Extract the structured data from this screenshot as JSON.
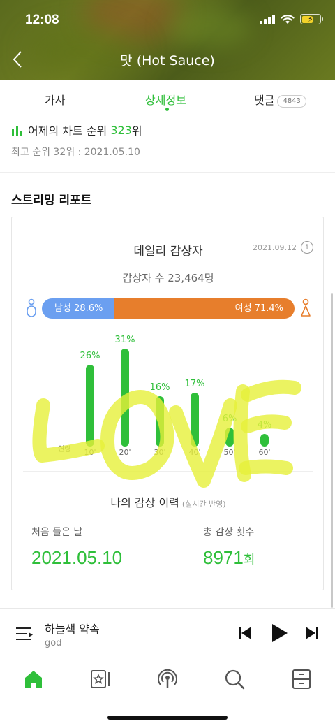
{
  "status_bar": {
    "time": "12:08"
  },
  "header": {
    "title": "맛 (Hot Sauce)"
  },
  "tabs": [
    {
      "label": "가사"
    },
    {
      "label": "상세정보"
    },
    {
      "label": "댓글",
      "badge": "4843"
    }
  ],
  "chart_rank": {
    "prefix": "어제의 차트 순위",
    "value": "323",
    "suffix": "위",
    "best": "최고 순위 32위 : 2021.05.10"
  },
  "streaming_report": {
    "section_title": "스트리밍 리포트",
    "card_title": "데일리 감상자",
    "date": "2021.09.12",
    "listener_count": "감상자 수 23,464명",
    "gender": {
      "male_label": "남성 28.6%",
      "female_label": "여성 71.4%",
      "male_pct": 28.6,
      "female_pct": 71.4,
      "male_color": "#6b9ff0",
      "female_color": "#e77e2c"
    },
    "age_axis_label": "연령",
    "ages": [
      {
        "label": "10'",
        "pct": 26,
        "pct_label": "26%"
      },
      {
        "label": "20'",
        "pct": 31,
        "pct_label": "31%"
      },
      {
        "label": "30'",
        "pct": 16,
        "pct_label": "16%"
      },
      {
        "label": "40'",
        "pct": 17,
        "pct_label": "17%"
      },
      {
        "label": "50'",
        "pct": 6,
        "pct_label": "6%"
      },
      {
        "label": "60'",
        "pct": 4,
        "pct_label": "4%"
      }
    ],
    "history_title": "나의 감상 이력",
    "history_sub": "(실시간 반영)",
    "first_listen_label": "처음 들은 날",
    "first_listen_value": "2021.05.10",
    "total_count_label": "총 감상 횟수",
    "total_count_value": "8971",
    "total_count_unit": "회",
    "accent_color": "#2fbf3a"
  },
  "player": {
    "title": "하늘색 약속",
    "artist": "god"
  },
  "bottom_nav": [
    "home-icon",
    "library-icon",
    "podcast-icon",
    "search-icon",
    "storage-icon"
  ]
}
